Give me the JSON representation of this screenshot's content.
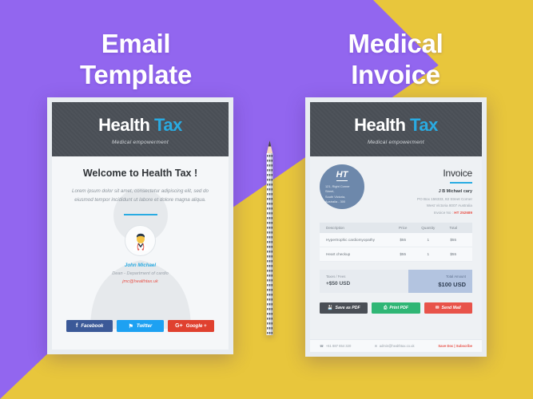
{
  "poster": {
    "left_title": "Email\nTemplate",
    "right_title": "Medical\nInvoice",
    "bg_purple": "#9266ef",
    "bg_yellow": "#e8c63c"
  },
  "brand": {
    "name_first": "Health",
    "name_second": "Tax",
    "tagline": "Medical empowerment",
    "accent_color": "#29abe2",
    "header_bg": "#4a4f56"
  },
  "email_card": {
    "welcome": "Welcome to Health Tax !",
    "lorem": "Lorem ipsum dolor sit amet, consectetur adipiscing elit, sed do  eiusmod tempor incididunt ut labore et dolore magna aliqua.",
    "avatar_icon": "doctor-avatar-icon",
    "doctor_name": "John Michael",
    "doctor_role": "Dean - Department of cardio",
    "doctor_email": "jmc@healthtax.uk",
    "social": [
      {
        "label": "Facebook",
        "icon": "facebook-icon",
        "glyph": "f",
        "color": "#3b5998"
      },
      {
        "label": "Twitter",
        "icon": "twitter-icon",
        "glyph": "⚑",
        "color": "#1da1f2"
      },
      {
        "label": "Google +",
        "icon": "google-plus-icon",
        "glyph": "G+",
        "color": "#e0412f"
      }
    ]
  },
  "invoice_card": {
    "logo_mark": "HT",
    "logo_address": "121, Right  Corner Street,\nSouth Victoria,\nAustralia - 300",
    "title": "Invoice",
    "client_name": "J B Michael cary",
    "client_address_1": "PO Box 156333, 82 Street Corner",
    "client_address_2": "West Victoria 8007 Australia",
    "invoice_no_label": "Invoice No :",
    "invoice_no_value": "HT 252689",
    "table": {
      "headers": [
        "Description",
        "Price",
        "Quantity",
        "Total"
      ],
      "rows": [
        {
          "description": "Hypertrophic cardiomyopathy",
          "price": "$55",
          "quantity": "1",
          "total": "$55"
        },
        {
          "description": "Heart checkup",
          "price": "$55",
          "quantity": "1",
          "total": "$55"
        }
      ]
    },
    "totals": {
      "taxes_label": "Taxes / Fees",
      "taxes_value": "+$50 USD",
      "total_label": "Total Amount",
      "total_value": "$100 USD"
    },
    "actions": [
      {
        "label": "Save as PDF",
        "icon": "save-icon",
        "glyph": "💾",
        "color": "#4a4f56"
      },
      {
        "label": "Print PDF",
        "icon": "print-icon",
        "glyph": "⎙",
        "color": "#2fb675"
      },
      {
        "label": "Send Mail",
        "icon": "mail-icon",
        "glyph": "✉",
        "color": "#e8534a"
      }
    ],
    "footer": {
      "phone_icon": "phone-icon",
      "phone": "+61 887 654 320",
      "email_icon": "envelope-icon",
      "email": "admin@healthtax.co.uk",
      "link": "Save Doc | Subscribe"
    }
  },
  "decor": {
    "pencil_icon": "pencil-icon"
  }
}
